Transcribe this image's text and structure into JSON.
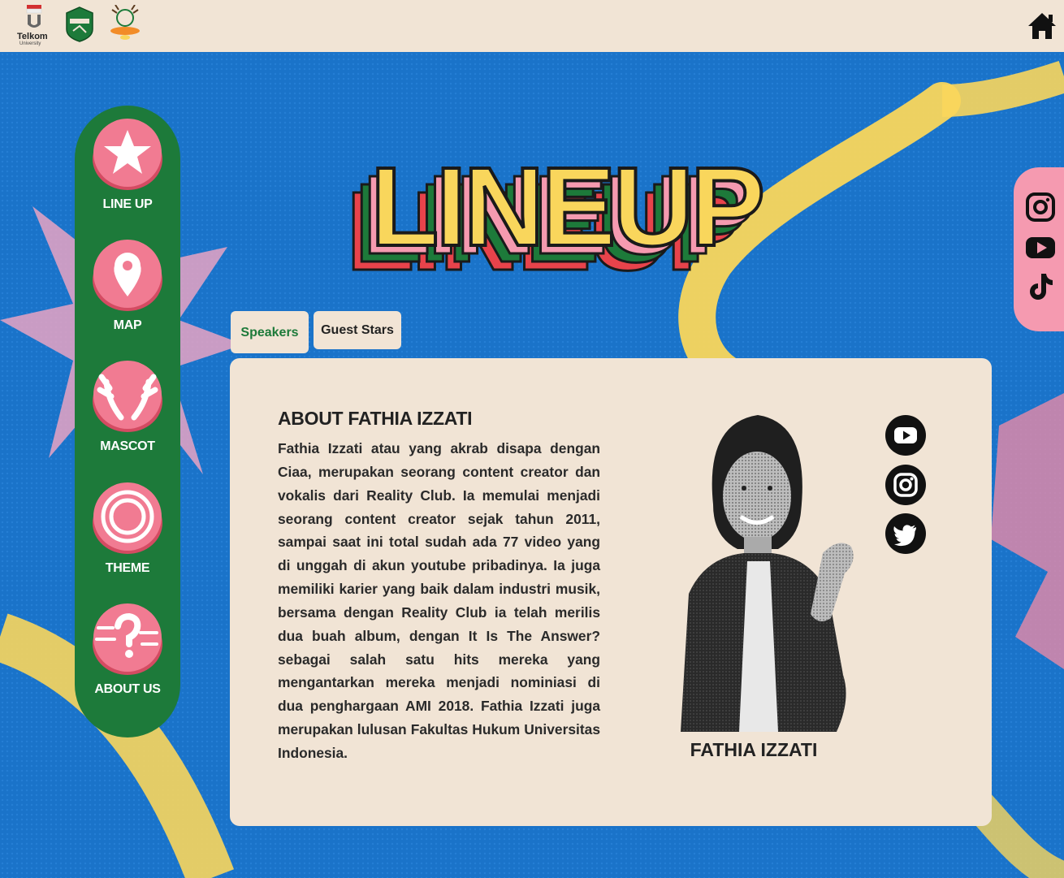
{
  "header": {
    "logos": [
      {
        "name": "telkom-university-logo",
        "text": "Telkom",
        "subtext": "University"
      },
      {
        "name": "forcy-logo"
      },
      {
        "name": "festival-logo"
      }
    ],
    "home_icon": "home-icon"
  },
  "sidenav": {
    "items": [
      {
        "label": "LINE UP",
        "icon": "star-icon"
      },
      {
        "label": "MAP",
        "icon": "map-pin-icon"
      },
      {
        "label": "MASCOT",
        "icon": "antlers-icon"
      },
      {
        "label": "THEME",
        "icon": "rings-icon"
      },
      {
        "label": "ABOUT US",
        "icon": "question-icon"
      }
    ]
  },
  "social_bar": {
    "items": [
      "instagram-icon",
      "youtube-icon",
      "tiktok-icon"
    ]
  },
  "hero": {
    "title": "LINEUP"
  },
  "tabs": [
    {
      "label": "Speakers",
      "active": true
    },
    {
      "label": "Guest Stars",
      "active": false
    }
  ],
  "speaker": {
    "about_title": "ABOUT FATHIA IZZATI",
    "bio": "Fathia Izzati atau yang akrab disapa dengan Ciaa, merupakan seorang content creator dan vokalis dari Reality Club. Ia memulai menjadi seorang content creator sejak tahun 2011, sampai saat ini total sudah ada 77 video yang di unggah di akun youtube pribadinya. Ia juga memiliki karier yang baik dalam industri musik, bersama dengan Reality Club ia telah merilis dua buah album, dengan It Is The Answer? sebagai salah satu hits mereka yang mengantarkan mereka menjadi nominiasi di dua penghargaan AMI 2018. Fathia Izzati juga merupakan lulusan Fakultas Hukum Universitas Indonesia.",
    "name": "FATHIA IZZATI",
    "links": [
      "youtube-icon",
      "instagram-icon",
      "twitter-icon"
    ]
  },
  "colors": {
    "background": "#1a73c9",
    "cream": "#f1e4d5",
    "green": "#1d7a3a",
    "pink": "#f59ab0",
    "yellow": "#f9d65c",
    "red": "#e8434b"
  }
}
